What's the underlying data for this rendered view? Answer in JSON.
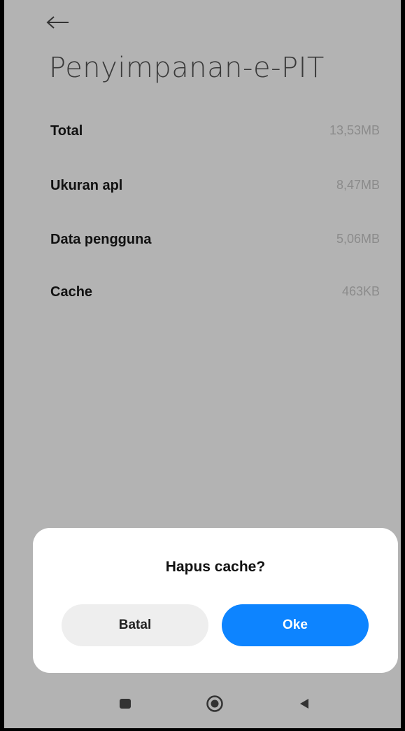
{
  "header": {
    "back_icon": "arrow-left-icon",
    "title": "Penyimpanan-e-PIT"
  },
  "storage": {
    "rows": [
      {
        "label": "Total",
        "value": "13,53MB"
      },
      {
        "label": "Ukuran apl",
        "value": "8,47MB"
      },
      {
        "label": "Data pengguna",
        "value": "5,06MB"
      },
      {
        "label": "Cache",
        "value": "463KB"
      }
    ]
  },
  "dialog": {
    "title": "Hapus cache?",
    "cancel_label": "Batal",
    "ok_label": "Oke"
  },
  "navbar": {
    "icons": [
      "recent-apps-icon",
      "home-icon",
      "back-icon"
    ]
  },
  "colors": {
    "background_dim": "#b3b3b3",
    "primary": "#0d84ff",
    "cancel_bg": "#eeeeee"
  }
}
